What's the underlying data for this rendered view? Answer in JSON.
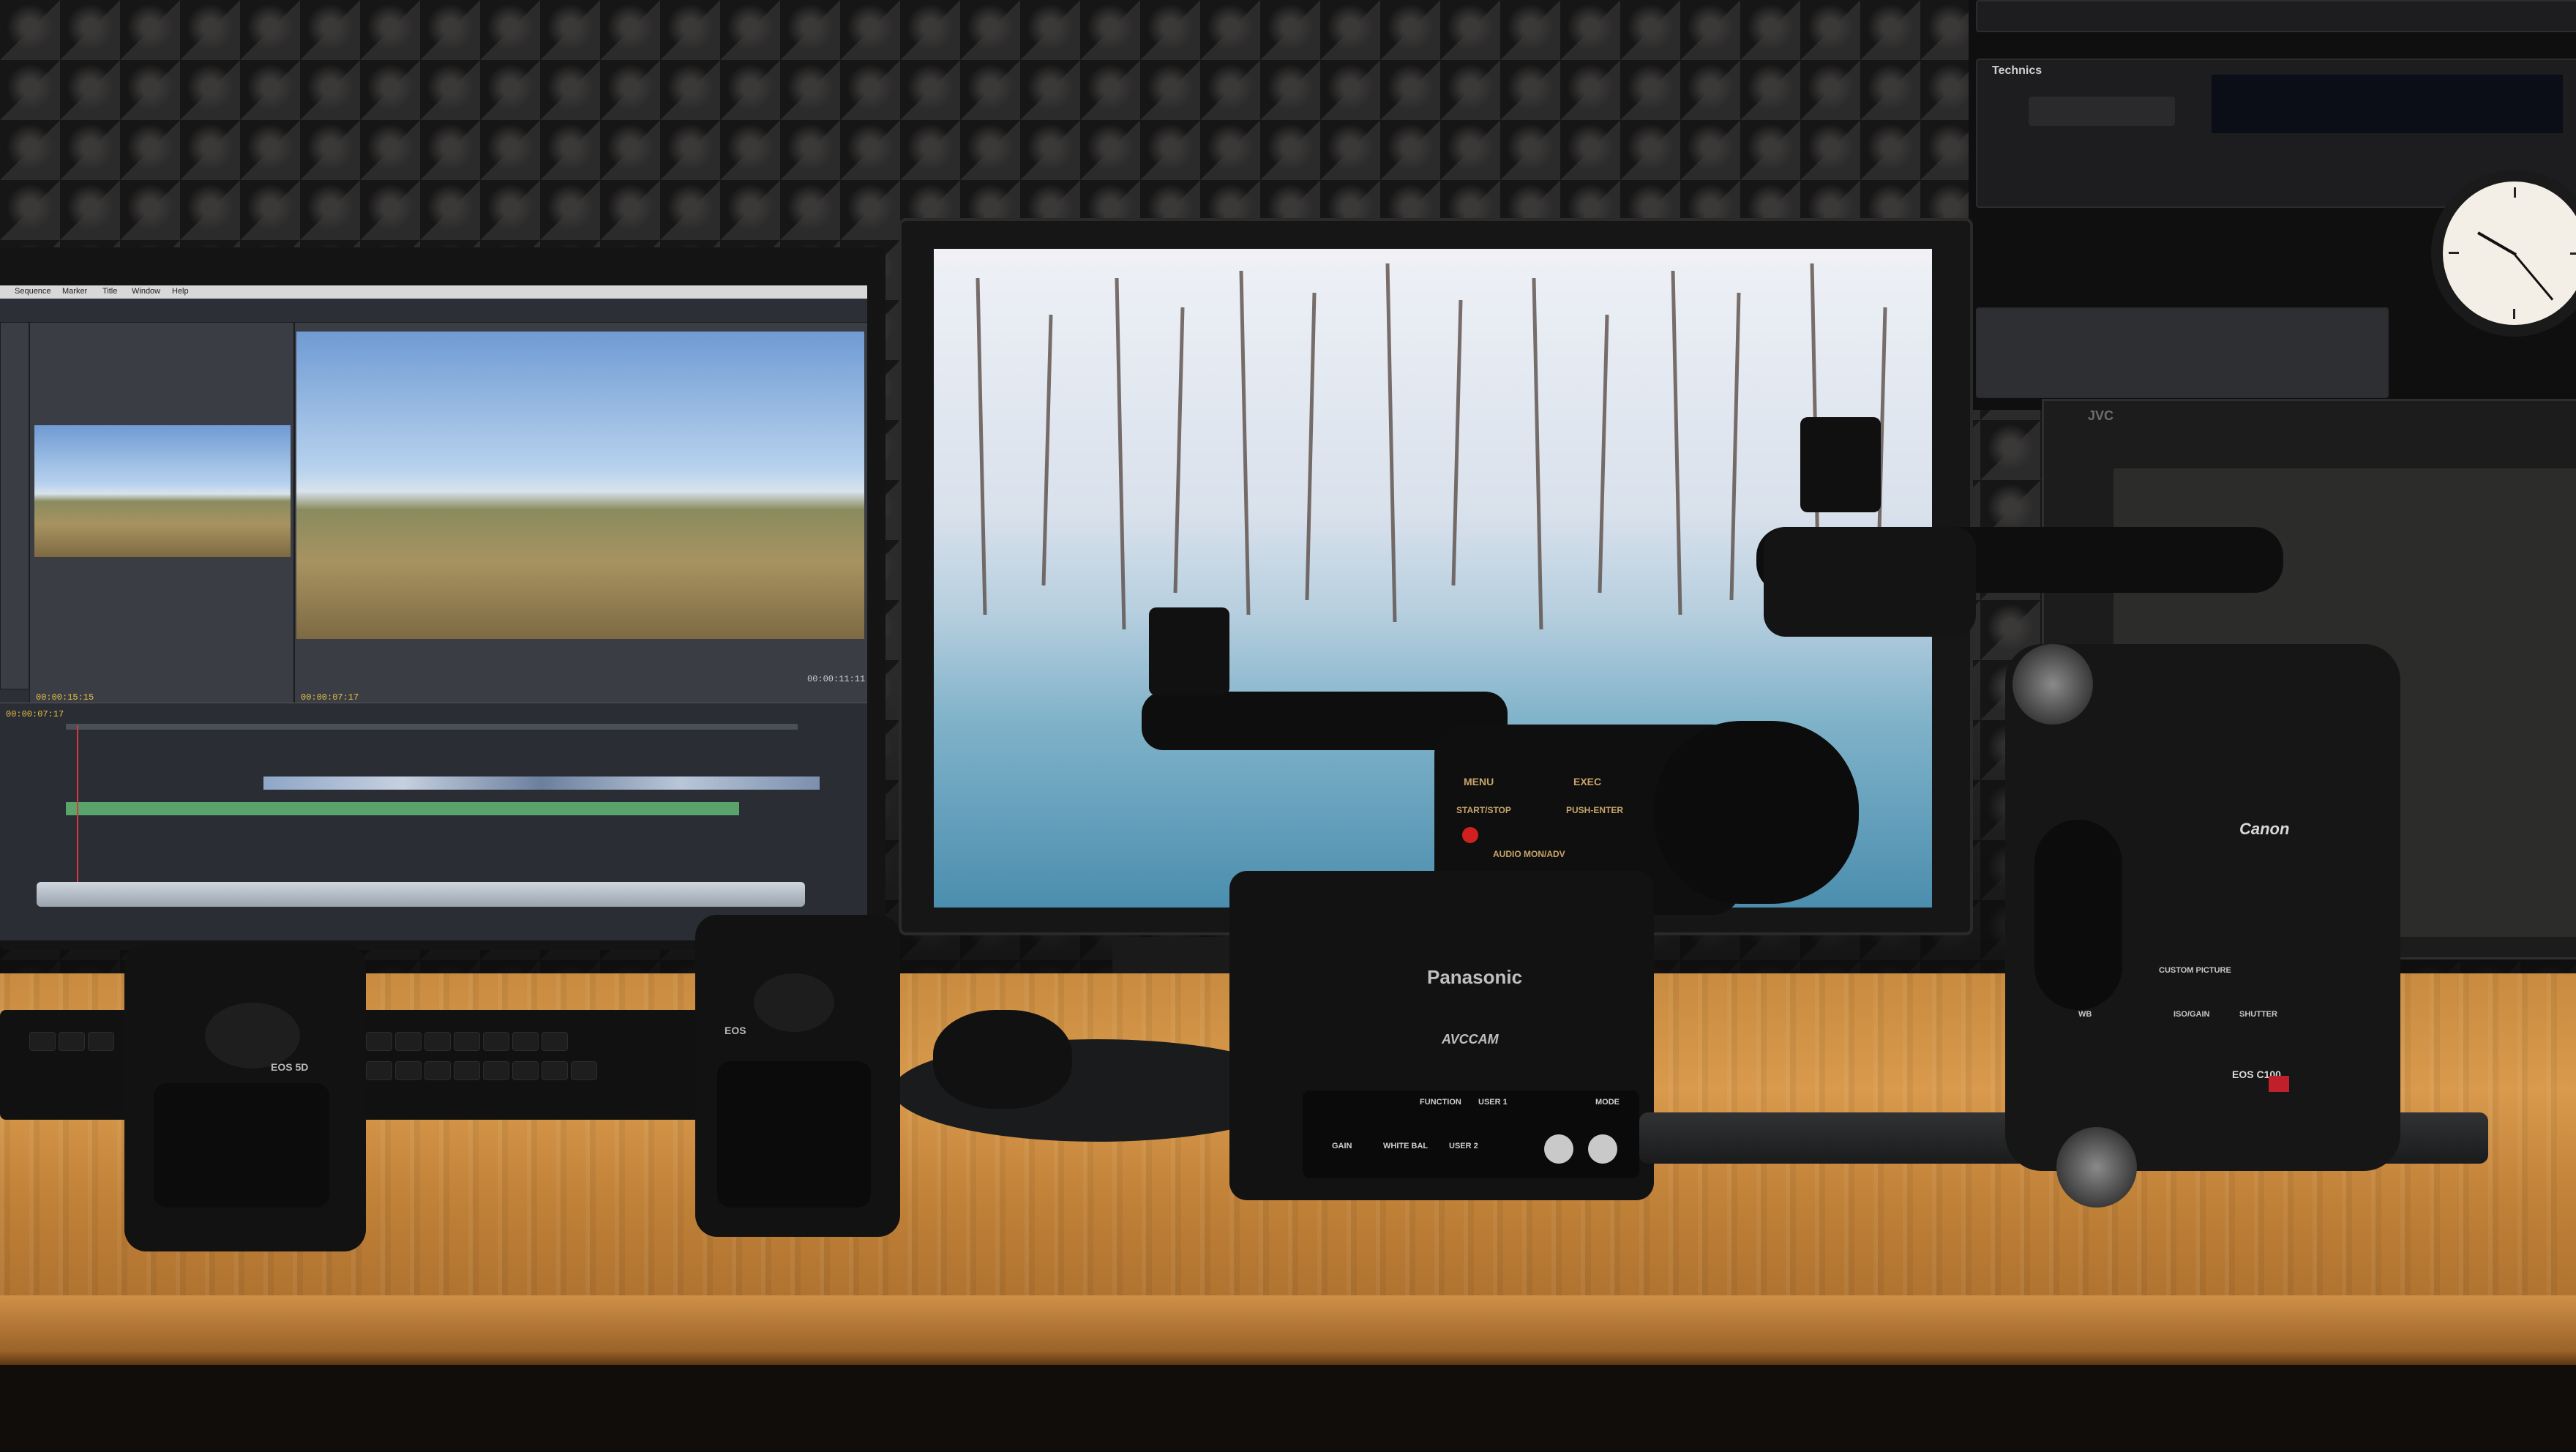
{
  "scene": {
    "left_monitor": {
      "menu_items": [
        "Sequence",
        "Marker",
        "Title",
        "Window",
        "Help"
      ],
      "source_timecode": "00:00:15:15",
      "program_timecode": "00:00:07:17",
      "program_duration": "00:00:11:11",
      "timeline_timecode": "00:00:07:17"
    },
    "camera_left_label": "EOS 5D",
    "camera_mid_label": "EOS",
    "panasonic_brand": "Panasonic",
    "panasonic_model": "AVCCAM",
    "panasonic_controls": [
      "MENU",
      "EXEC",
      "START/STOP",
      "PUSH-ENTER",
      "AUDIO MON/ADV",
      "FUNCTION",
      "USER 1",
      "MODE",
      "GAIN",
      "WHITE BAL",
      "USER 2"
    ],
    "canon_brand": "Canon",
    "canon_model": "EOS C100",
    "canon_controls": [
      "CUSTOM PICTURE",
      "ISO/GAIN",
      "SHUTTER",
      "WB"
    ],
    "technics_brand": "Technics",
    "jvc_brand": "JVC"
  }
}
